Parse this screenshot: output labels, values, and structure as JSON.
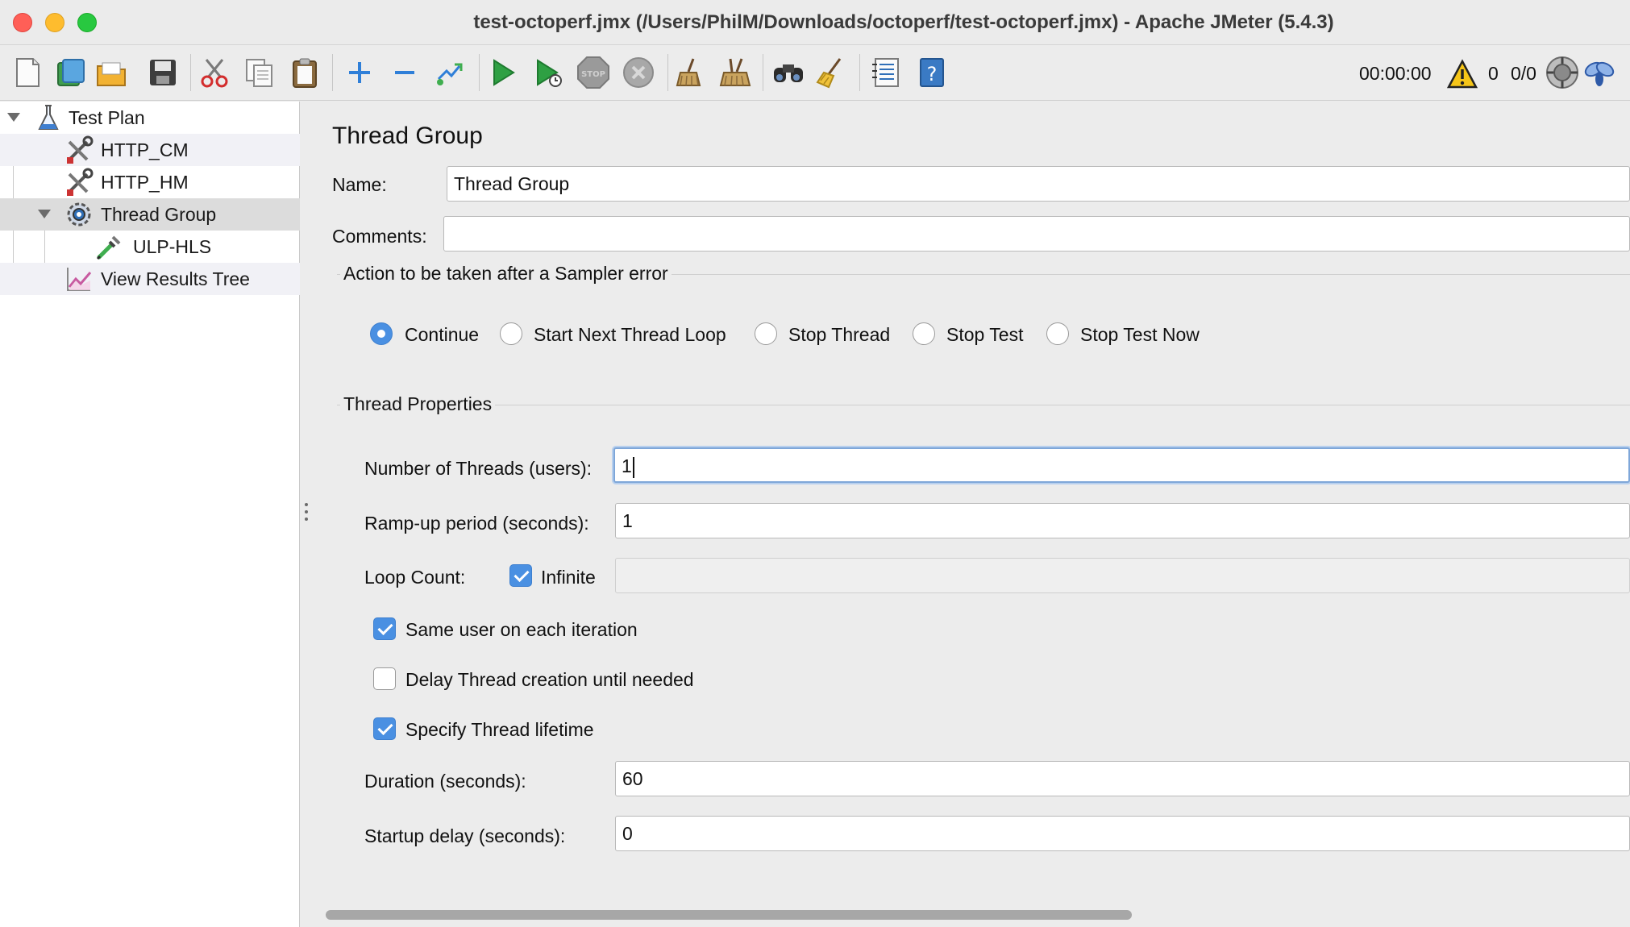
{
  "window": {
    "title": "test-octoperf.jmx (/Users/PhilM/Downloads/octoperf/test-octoperf.jmx) - Apache JMeter (5.4.3)"
  },
  "toolbar": {
    "buttons": [
      {
        "name": "new-icon"
      },
      {
        "name": "templates-icon"
      },
      {
        "name": "open-icon"
      },
      {
        "name": "save-icon"
      },
      {
        "name": "cut-icon"
      },
      {
        "name": "copy-icon"
      },
      {
        "name": "paste-icon"
      },
      {
        "name": "expand-icon"
      },
      {
        "name": "collapse-icon"
      },
      {
        "name": "toggle-icon"
      },
      {
        "name": "start-icon"
      },
      {
        "name": "start-no-pauses-icon"
      },
      {
        "name": "stop-icon"
      },
      {
        "name": "shutdown-icon"
      },
      {
        "name": "clear-icon"
      },
      {
        "name": "clear-all-icon"
      },
      {
        "name": "search-icon"
      },
      {
        "name": "reset-search-icon"
      },
      {
        "name": "function-helper-icon"
      },
      {
        "name": "help-icon"
      }
    ],
    "elapsed_time": "00:00:00",
    "warning_count": "0",
    "threads_active": "0/0"
  },
  "tree": {
    "items": [
      {
        "label": "Test Plan",
        "icon": "test-plan-icon"
      },
      {
        "label": "HTTP_CM",
        "icon": "config-element-icon"
      },
      {
        "label": "HTTP_HM",
        "icon": "config-element-icon"
      },
      {
        "label": "Thread Group",
        "icon": "thread-group-icon"
      },
      {
        "label": "ULP-HLS",
        "icon": "sampler-icon"
      },
      {
        "label": "View Results Tree",
        "icon": "listener-icon"
      }
    ]
  },
  "panel": {
    "title": "Thread Group",
    "name_label": "Name:",
    "name_value": "Thread Group",
    "comments_label": "Comments:",
    "comments_value": "",
    "sampler_error": {
      "title": "Action to be taken after a Sampler error",
      "options": [
        "Continue",
        "Start Next Thread Loop",
        "Stop Thread",
        "Stop Test",
        "Stop Test Now"
      ],
      "selected": "Continue"
    },
    "thread_props": {
      "title": "Thread Properties",
      "num_threads_label": "Number of Threads (users):",
      "num_threads_value": "1",
      "rampup_label": "Ramp-up period (seconds):",
      "rampup_value": "1",
      "loop_label": "Loop Count:",
      "infinite_label": "Infinite",
      "infinite_checked": true,
      "loop_value": "",
      "same_user_label": "Same user on each iteration",
      "same_user_checked": true,
      "delay_label": "Delay Thread creation until needed",
      "delay_checked": false,
      "lifetime_label": "Specify Thread lifetime",
      "lifetime_checked": true,
      "duration_label": "Duration (seconds):",
      "duration_value": "60",
      "startup_label": "Startup delay (seconds):",
      "startup_value": "0"
    }
  }
}
